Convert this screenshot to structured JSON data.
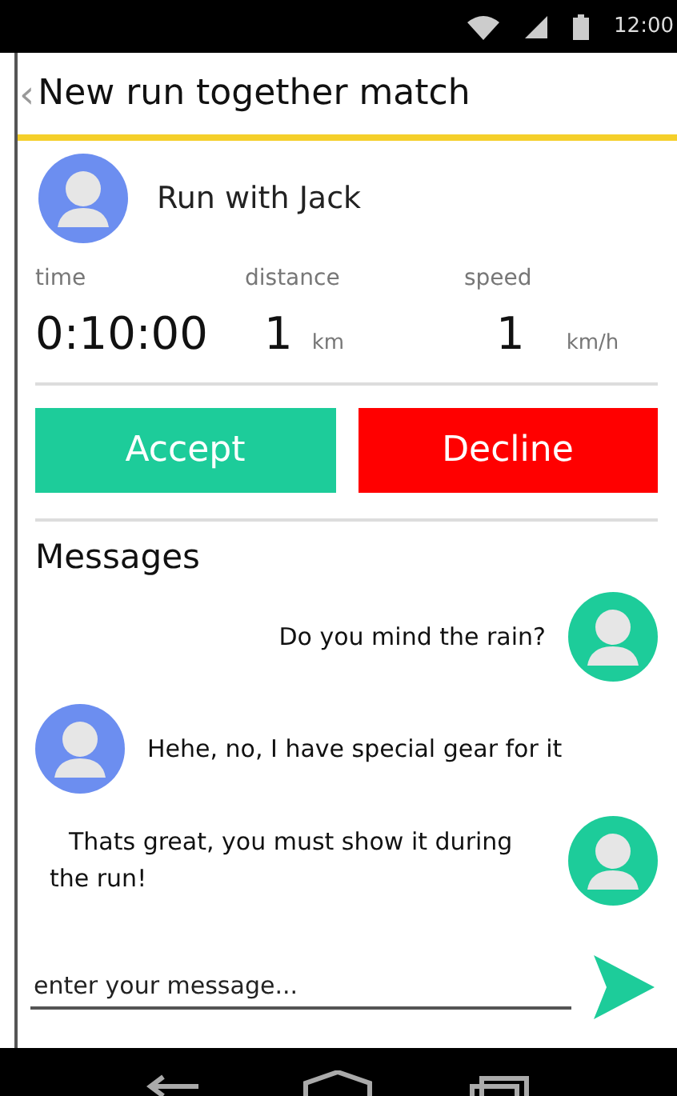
{
  "status_bar": {
    "time": "12:00"
  },
  "title_bar": {
    "back_icon": "‹",
    "title": "New run together match"
  },
  "match": {
    "name": "Run with Jack",
    "stats": [
      {
        "label": "time",
        "value": "0:10:00"
      },
      {
        "label": "distance",
        "value": "1",
        "unit": "km"
      },
      {
        "label": "speed",
        "value": "1",
        "unit": "km/h"
      }
    ]
  },
  "buttons": [
    {
      "kind": "accept",
      "label": "Accept"
    },
    {
      "kind": "decline",
      "label": "Decline"
    }
  ],
  "messages": {
    "heading": "Messages",
    "items": [
      {
        "kind": "sent",
        "text": "Do you mind the rain?"
      },
      {
        "kind": "received",
        "text": "Hehe, no, I have special gear for it"
      },
      {
        "kind": "sent",
        "text": "Thats great, you must show it during the run!"
      }
    ]
  },
  "composer": {
    "placeholder": "enter your message..."
  }
}
